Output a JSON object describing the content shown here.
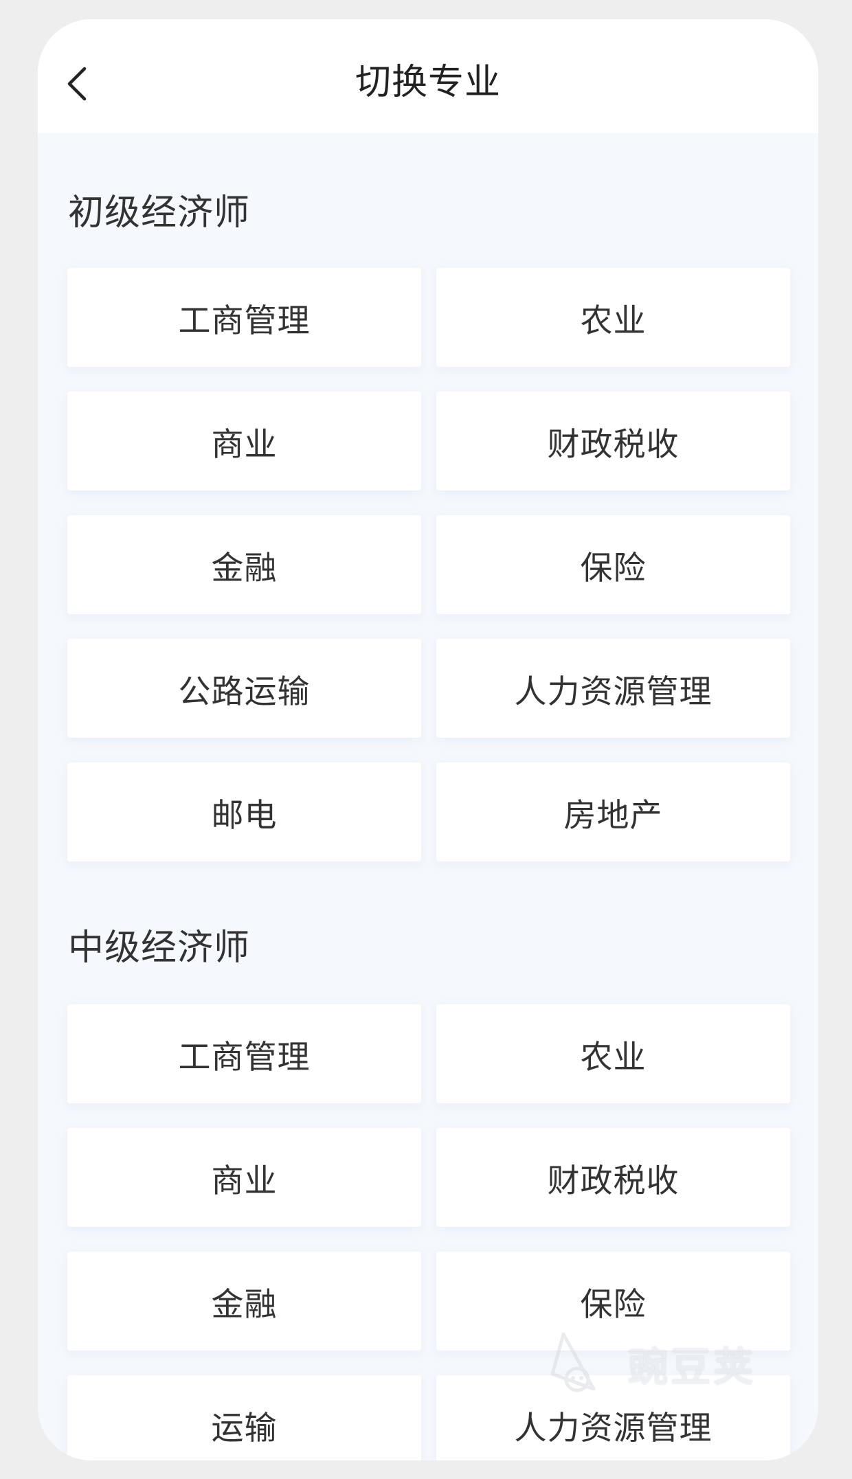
{
  "header": {
    "title": "切换专业",
    "back_icon": "chevron-left-icon"
  },
  "sections": [
    {
      "title": "初级经济师",
      "items": [
        "工商管理",
        "农业",
        "商业",
        "财政税收",
        "金融",
        "保险",
        "公路运输",
        "人力资源管理",
        "邮电",
        "房地产"
      ]
    },
    {
      "title": "中级经济师",
      "items": [
        "工商管理",
        "农业",
        "商业",
        "财政税收",
        "金融",
        "保险",
        "运输",
        "人力资源管理"
      ]
    }
  ],
  "watermark": {
    "text": "豌豆荚",
    "icon": "wandoujia-logo-icon"
  },
  "colors": {
    "background": "#f5f8fd",
    "card": "#ffffff",
    "text": "#333333"
  }
}
